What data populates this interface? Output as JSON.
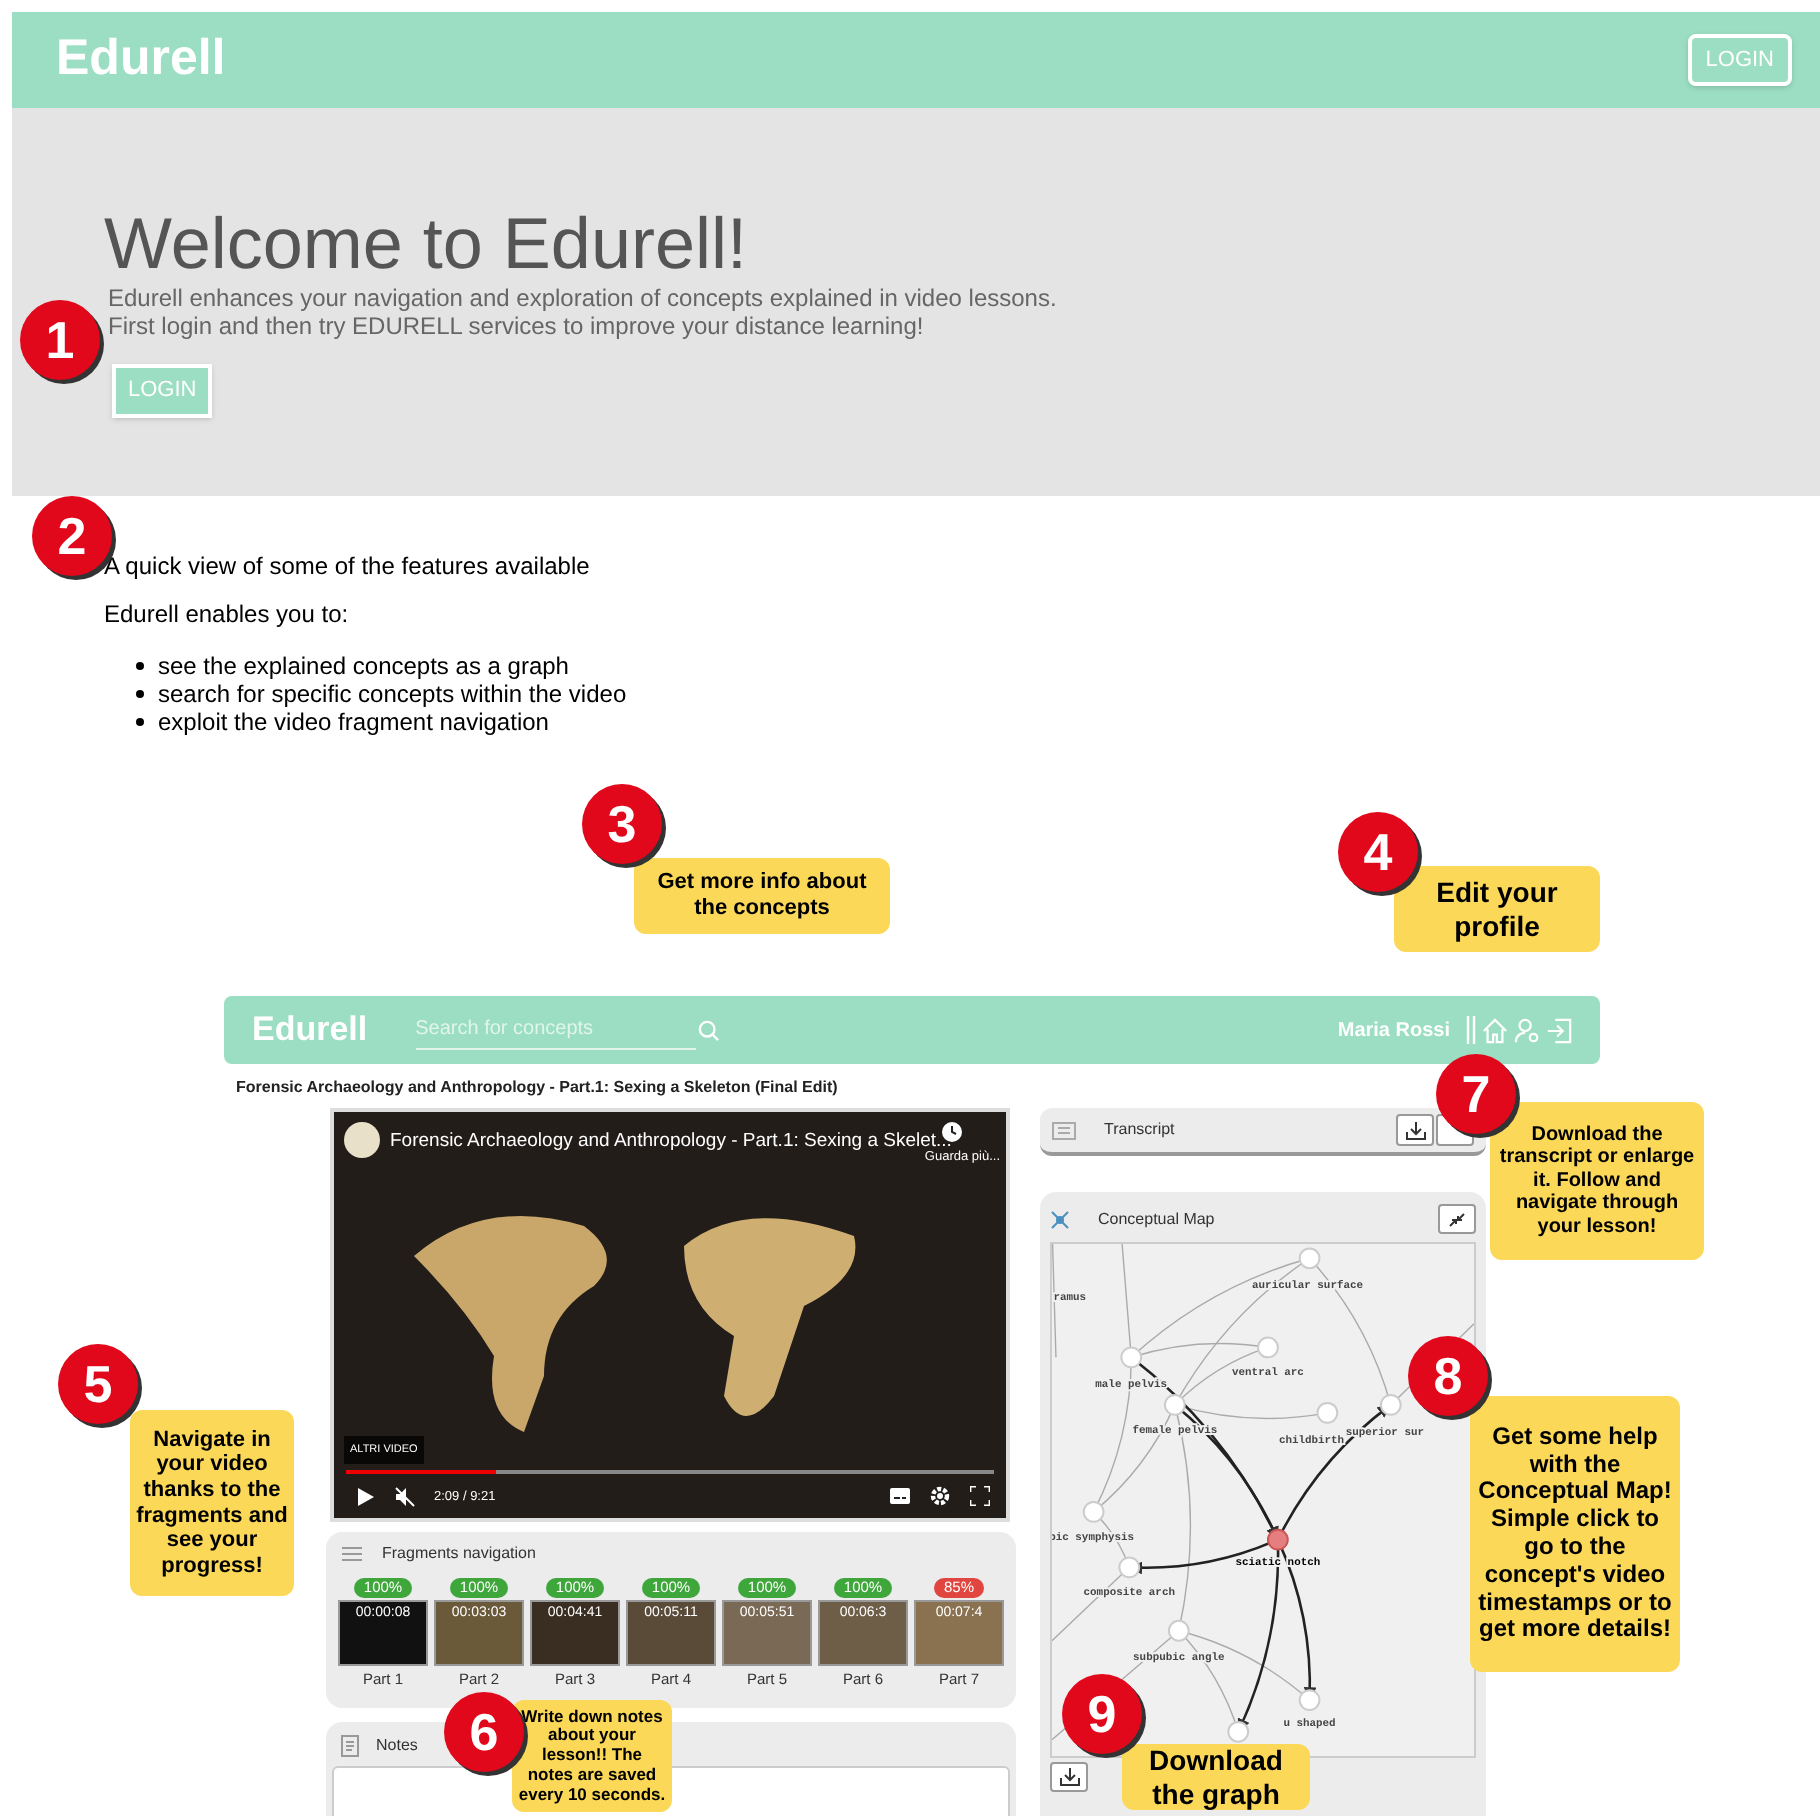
{
  "header": {
    "logo": "Edurell",
    "login": "LOGIN"
  },
  "hero": {
    "title": "Welcome to Edurell!",
    "lines": [
      "Edurell enhances your navigation and exploration of concepts explained in video lessons.",
      "First login and then try EDURELL services to improve your distance learning!"
    ],
    "login": "LOGIN"
  },
  "features": {
    "heading": "A quick view of some of the features available",
    "intro": "Edurell enables you to:",
    "items": [
      "see the explained concepts as a graph",
      "search for specific concepts within the video",
      "exploit the video fragment navigation"
    ]
  },
  "app": {
    "logo": "Edurell",
    "search_placeholder": "Search for concepts",
    "user": "Maria Rossi",
    "lesson_title": "Forensic Archaeology and Anthropology - Part.1: Sexing a Skeleton (Final Edit)",
    "video": {
      "title": "Forensic Archaeology and Anthropology - Part.1: Sexing a Skelet...",
      "watch_later": "Guarda più...",
      "more_videos": "ALTRI VIDEO",
      "time": "2:09 / 9:21",
      "level": 0.23
    },
    "fragments_title": "Fragments navigation",
    "fragments": [
      {
        "percent": "100%",
        "color": "#3fa63c",
        "time": "00:00:08",
        "label": "Part 1"
      },
      {
        "percent": "100%",
        "color": "#3fa63c",
        "time": "00:03:03",
        "label": "Part 2"
      },
      {
        "percent": "100%",
        "color": "#3fa63c",
        "time": "00:04:41",
        "label": "Part 3"
      },
      {
        "percent": "100%",
        "color": "#3fa63c",
        "time": "00:05:11",
        "label": "Part 4"
      },
      {
        "percent": "100%",
        "color": "#3fa63c",
        "time": "00:05:51",
        "label": "Part 5"
      },
      {
        "percent": "100%",
        "color": "#3fa63c",
        "time": "00:06:3",
        "label": "Part 6"
      },
      {
        "percent": "85%",
        "color": "#e0453f",
        "time": "00:07:4",
        "label": "Part 7"
      }
    ],
    "notes_title": "Notes",
    "transcript_title": "Transcript",
    "map_title": "Conceptual Map",
    "map_nodes": [
      {
        "label": "auricular surface",
        "selected": false
      },
      {
        "label": "ramus",
        "selected": false
      },
      {
        "label": "male pelvis",
        "selected": false
      },
      {
        "label": "ventral arc",
        "selected": false
      },
      {
        "label": "female pelvis",
        "selected": false
      },
      {
        "label": "childbirth",
        "selected": false
      },
      {
        "label": "superior sur",
        "selected": false
      },
      {
        "label": "bic symphysis",
        "selected": false
      },
      {
        "label": "sciatic notch",
        "selected": true
      },
      {
        "label": "composite arch",
        "selected": false
      },
      {
        "label": "subpubic angle",
        "selected": false
      },
      {
        "label": "u shaped",
        "selected": false
      }
    ]
  },
  "annotations": [
    {
      "number": "1"
    },
    {
      "number": "2"
    },
    {
      "number": "3",
      "text": "Get more info about the concepts"
    },
    {
      "number": "4",
      "text": "Edit your profile"
    },
    {
      "number": "5",
      "text": "Navigate in your video thanks to the fragments and see your progress!"
    },
    {
      "number": "6",
      "text": "Write down notes about your lesson!! The notes are saved every 10 seconds."
    },
    {
      "number": "7",
      "text": "Download the transcript or enlarge it. Follow and navigate through your lesson!"
    },
    {
      "number": "8",
      "text": "Get some help with the Conceptual Map! Simple click to go to the concept's video timestamps or to get more details!"
    },
    {
      "number": "9",
      "text": "Download the graph"
    }
  ]
}
